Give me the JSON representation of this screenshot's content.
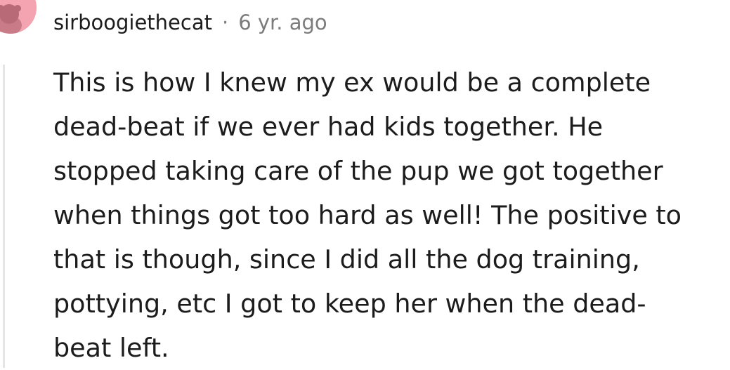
{
  "comment": {
    "username": "sirboogiethecat",
    "separator": "·",
    "timestamp": "6 yr. ago",
    "body_lines": [
      "This is how I knew my ex would be a complete",
      "dead-beat if we ever had kids together. He",
      "stopped taking care of the pup we got together",
      "when things got too hard as well! The positive to",
      "that is though, since I did all the dog training,",
      "pottying, etc I got to keep her when the dead-",
      "beat left."
    ]
  },
  "colors": {
    "avatar_background": "#f4a3b1",
    "text": "#1c1c1c",
    "meta": "#7c7c7c",
    "thread_line": "#e5e5e5"
  },
  "icons": {
    "avatar": "snoo-avatar-icon"
  }
}
